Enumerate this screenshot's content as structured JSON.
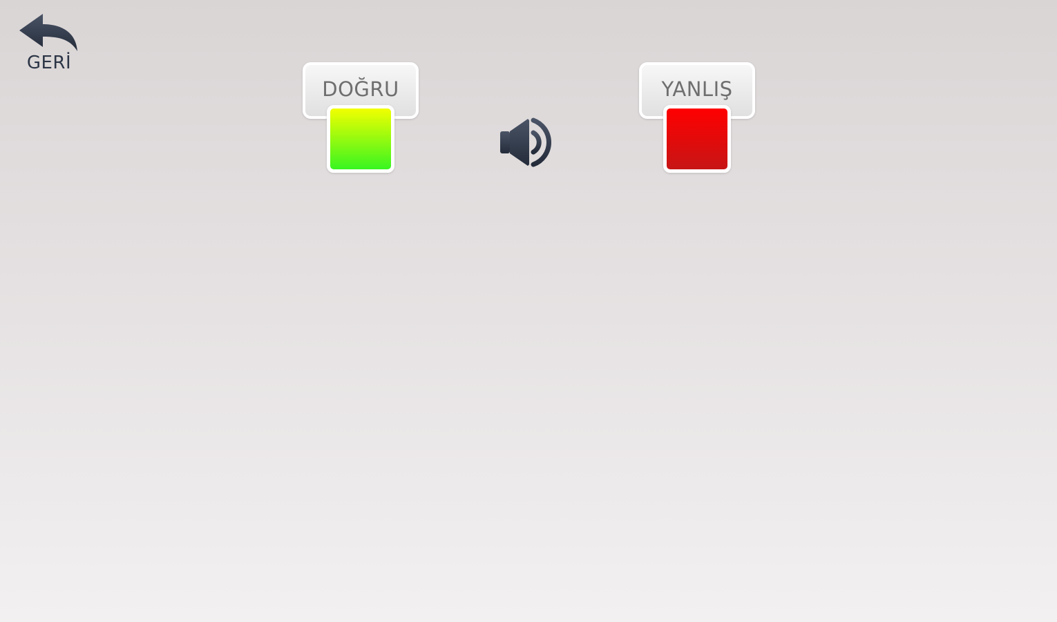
{
  "navigation": {
    "back_label": "GERİ",
    "back_icon": "undo-arrow-icon"
  },
  "answers": [
    {
      "label": "DOĞRU",
      "color_top": "#f2ff00",
      "color_bottom": "#38f520"
    },
    {
      "label": "YANLIŞ",
      "color_top": "#ff0000",
      "color_bottom": "#c71515"
    }
  ],
  "audio": {
    "icon": "speaker-icon"
  },
  "colors": {
    "icon": "#2c3546",
    "label_text": "#6e6e6e"
  }
}
